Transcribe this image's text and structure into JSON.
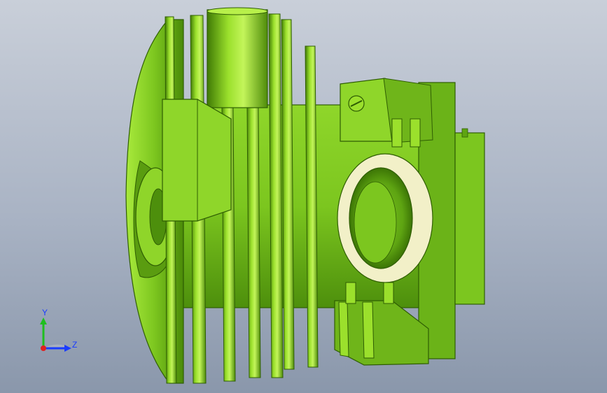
{
  "viewport": {
    "background_top": "#c9cfd9",
    "background_bottom": "#8a97ab",
    "model": {
      "description_colors": {
        "body": "#7cc61f",
        "body_dark": "#3f7a05",
        "body_light": "#b8f04a",
        "port_ring": "#f2f0c8"
      }
    }
  },
  "triad": {
    "y_label": "Y",
    "z_label": "Z",
    "y_color": "#1fbf1f",
    "z_color": "#1a3cff",
    "x_color": "#e02020"
  }
}
